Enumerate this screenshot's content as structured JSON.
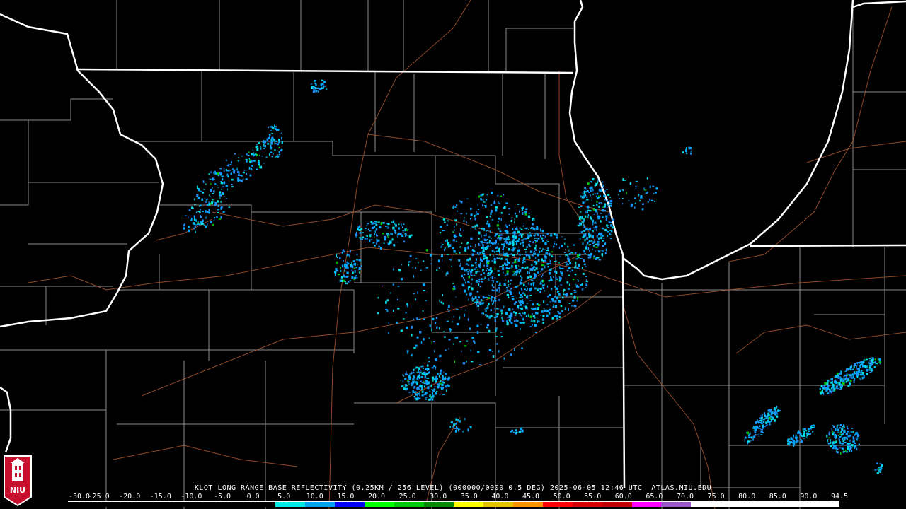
{
  "title": "KLOT LONG RANGE BASE REFLECTIVITY (0.25KM / 256 LEVEL) (000000/0000 0.5 DEG) 2025-06-05 12:46 UTC  ATLAS.NIU.EDU",
  "logo_text": "NIU",
  "colorbar": {
    "ticks": [
      "-30.0",
      "-25.0",
      "-20.0",
      "-15.0",
      "-10.0",
      "-5.0",
      "0.0",
      "5.0",
      "10.0",
      "15.0",
      "20.0",
      "25.0",
      "30.0",
      "35.0",
      "40.0",
      "45.0",
      "50.0",
      "55.0",
      "60.0",
      "65.0",
      "70.0",
      "75.0",
      "80.0",
      "85.0",
      "90.0",
      "94.5"
    ],
    "colors": [
      "#000000",
      "#000000",
      "#000000",
      "#000000",
      "#000000",
      "#000000",
      "#000000",
      "#00e8e8",
      "#009ef0",
      "#0000f6",
      "#00ff00",
      "#00c800",
      "#008c00",
      "#ffff00",
      "#e7c000",
      "#ff9000",
      "#ff0000",
      "#d60000",
      "#c00000",
      "#ff00ff",
      "#9955c9",
      "#ffffff",
      "#ffffff",
      "#ffffff",
      "#ffffff",
      "#ffffff"
    ]
  },
  "colors": {
    "background": "#000000",
    "state_border": "#ffffff",
    "county_line": "#8c8c8c",
    "road": "#a0522d",
    "echo_light": "#00aaff",
    "echo_cyan": "#00e0e8",
    "echo_green": "#00c800"
  }
}
